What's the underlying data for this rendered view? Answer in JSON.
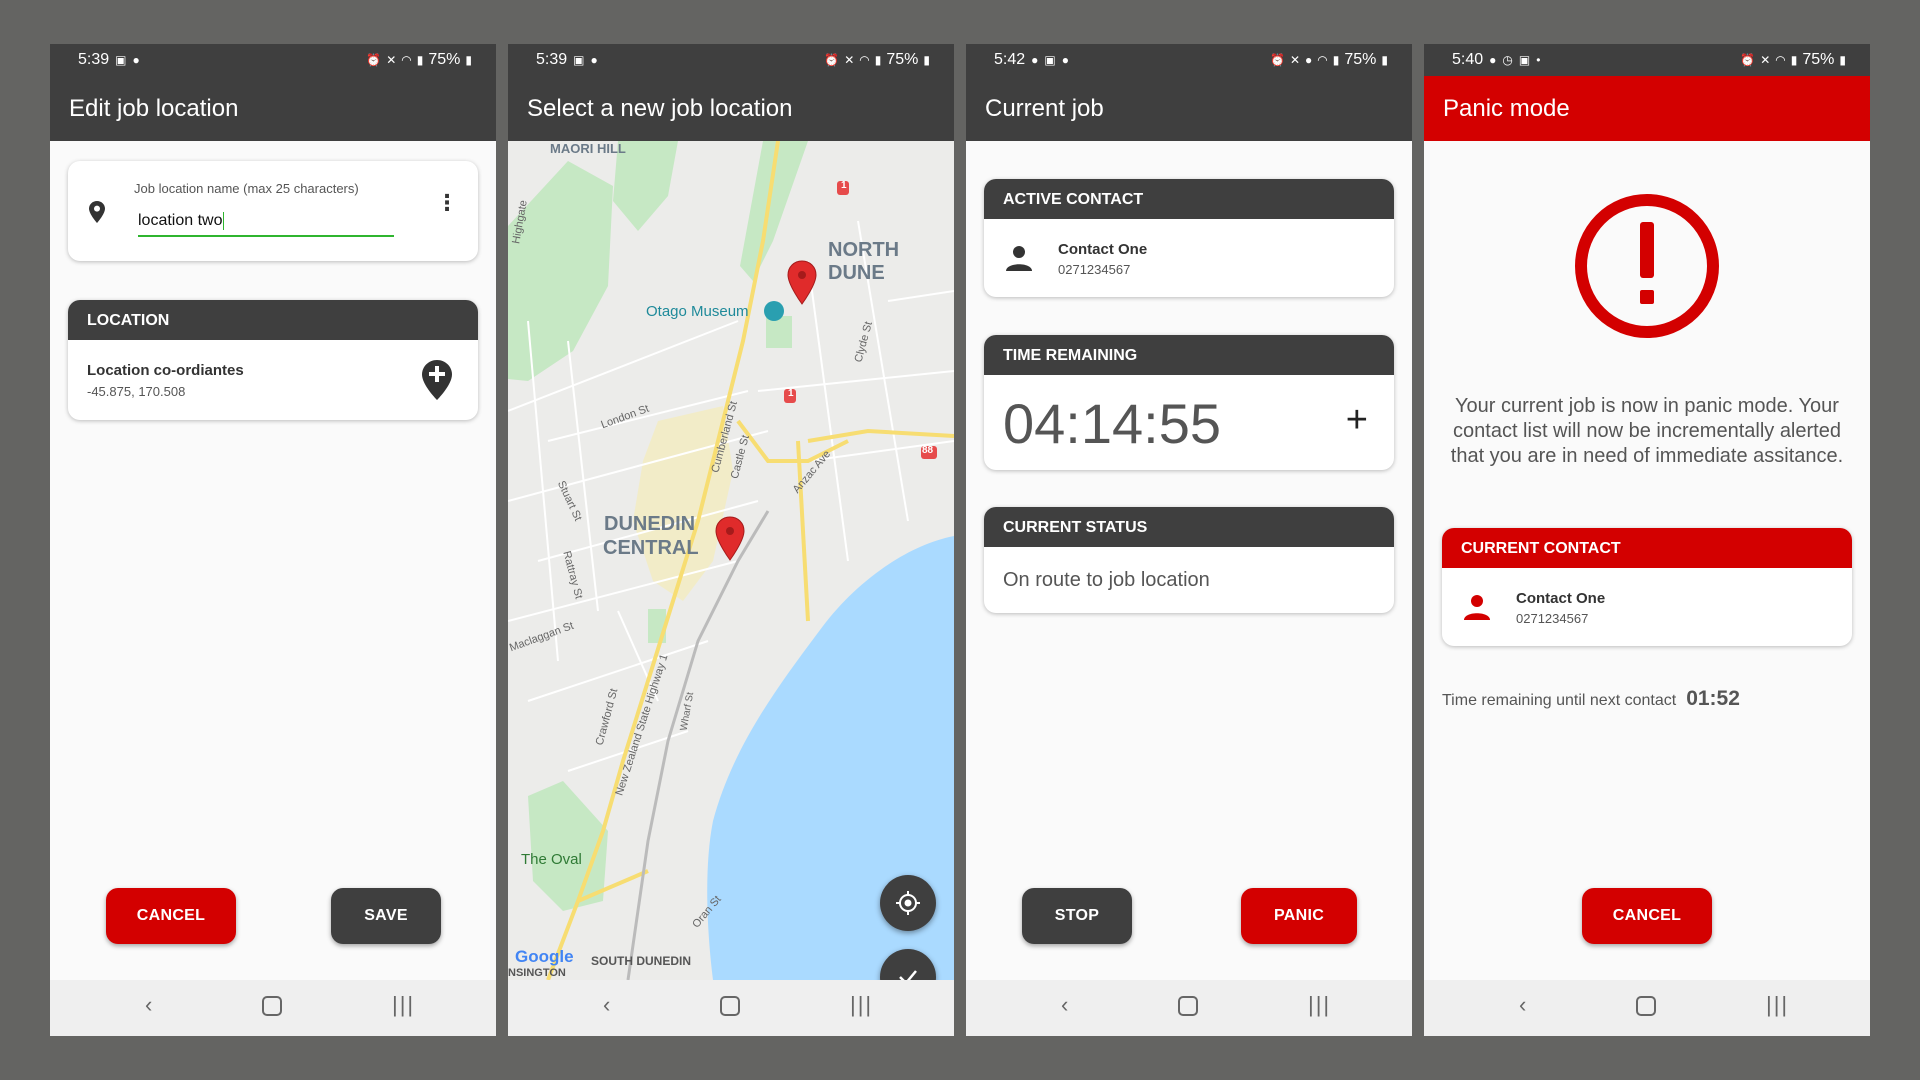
{
  "colors": {
    "dark": "#3f3f3f",
    "red": "#d30000",
    "accent_green": "#2fb52f",
    "water": "#aadaff"
  },
  "screens": [
    {
      "status": {
        "time": "5:39",
        "battery": "75%"
      },
      "title": "Edit job location",
      "field": {
        "label": "Job location name (max 25 characters)",
        "value": "location two"
      },
      "location_card": {
        "header": "LOCATION",
        "label": "Location co-ordiantes",
        "coords": "-45.875, 170.508"
      },
      "buttons": {
        "cancel": "CANCEL",
        "save": "SAVE"
      }
    },
    {
      "status": {
        "time": "5:39",
        "battery": "75%"
      },
      "title": "Select a new job location",
      "map_labels": {
        "maori_hill": "MAORI HILL",
        "north_dune": "NORTH DUNE",
        "otago_museum": "Otago Museum",
        "dunedin_central_1": "DUNEDIN",
        "dunedin_central_2": "CENTRAL",
        "london_st": "London St",
        "stuart_st": "Stuart St",
        "rattray_st": "Rattray St",
        "maclaggan_st": "Maclaggan St",
        "cumberland_st": "Cumberland St",
        "castle_st": "Castle St",
        "anzac_ave": "Anzac Ave",
        "clyde_st": "Clyde St",
        "highgate": "Highgate",
        "crawford_st": "Crawford St",
        "state_highway": "New Zealand State Highway 1",
        "the_oval": "The Oval",
        "south_dunedin": "SOUTH DUNEDIN",
        "kensington": "NSINGTON",
        "wharf_st": "Wharf St",
        "oran_st": "Oran St",
        "google": "Google",
        "shield_1a": "1",
        "shield_1b": "1",
        "shield_88": "88"
      }
    },
    {
      "status": {
        "time": "5:42",
        "battery": "75%"
      },
      "title": "Current job",
      "active_contact": {
        "header": "ACTIVE CONTACT",
        "name": "Contact One",
        "phone": "0271234567"
      },
      "time_remaining": {
        "header": "TIME REMAINING",
        "value": "04:14:55"
      },
      "current_status": {
        "header": "CURRENT STATUS",
        "value": "On route to job location"
      },
      "buttons": {
        "stop": "STOP",
        "panic": "PANIC"
      }
    },
    {
      "status": {
        "time": "5:40",
        "battery": "75%"
      },
      "title": "Panic mode",
      "message": "Your current job is now in panic mode. Your contact list will now be incrementally alerted that you are in need of immediate assitance.",
      "current_contact": {
        "header": "CURRENT CONTACT",
        "name": "Contact One",
        "phone": "0271234567"
      },
      "next_contact": {
        "label": "Time remaining until next contact",
        "value": "01:52"
      },
      "buttons": {
        "cancel": "CANCEL"
      }
    }
  ]
}
